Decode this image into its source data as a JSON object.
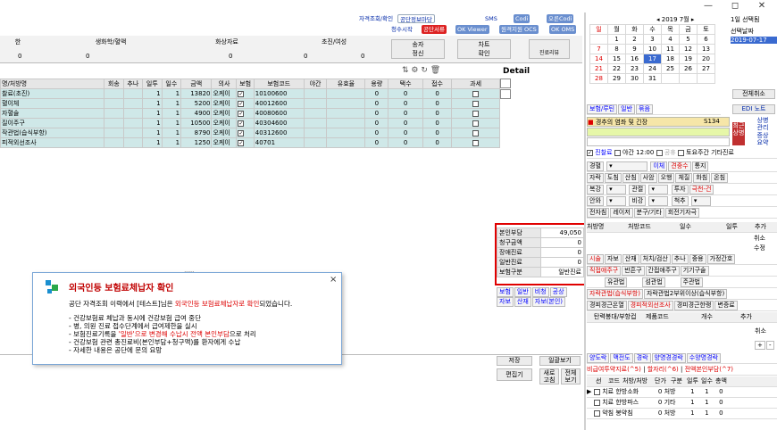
{
  "window_controls": [
    "—",
    "◻",
    "✕"
  ],
  "toolbar_top": {
    "row1": [
      "자격조회/확인",
      "공단정보마당",
      "SMS",
      "Codi",
      "오른Codi"
    ],
    "row2": [
      "청수시작",
      "공단서류",
      "OK Viewer",
      "원격지원 OCS",
      "OK OMS"
    ]
  },
  "header_cells": [
    "생화학/혈액",
    "화상자료",
    "초진/여성",
    "송자\n정신",
    "차트\n확인",
    "진료리뷰"
  ],
  "header_values": [
    "0",
    "0",
    "0",
    "0",
    "0"
  ],
  "header_left_label": "한",
  "grid": {
    "columns": [
      "명/처방명",
      "회송",
      "추나",
      "일투",
      "일수",
      "금액",
      "의사",
      "보험",
      "보험코드",
      "야간",
      "유효율",
      "용량",
      "택수",
      "접수",
      "과세"
    ],
    "rows": [
      {
        "name": "찰료(초진)",
        "v1": "1",
        "v2": "1",
        "amount": "13820",
        "doctor": "오케이",
        "ins": true,
        "code": "10100600",
        "c1": "0",
        "c2": "0",
        "c3": "0"
      },
      {
        "name": "혈이체",
        "v1": "1",
        "v2": "1",
        "amount": "5200",
        "doctor": "오케이",
        "ins": true,
        "code": "40012600",
        "c1": "0",
        "c2": "0",
        "c3": "0"
      },
      {
        "name": "자혈술",
        "v1": "1",
        "v2": "1",
        "amount": "4900",
        "doctor": "오케이",
        "ins": true,
        "code": "40080600",
        "c1": "0",
        "c2": "0",
        "c3": "0"
      },
      {
        "name": "질이주구",
        "v1": "1",
        "v2": "1",
        "amount": "10500",
        "doctor": "오케이",
        "ins": true,
        "code": "40304600",
        "c1": "0",
        "c2": "0",
        "c3": "0"
      },
      {
        "name": "작관법(습식부항)",
        "v1": "1",
        "v2": "1",
        "amount": "8790",
        "doctor": "오케이",
        "ins": true,
        "code": "40312600",
        "c1": "0",
        "c2": "0",
        "c3": "0"
      },
      {
        "name": "피적외선조사",
        "v1": "1",
        "v2": "1",
        "amount": "1250",
        "doctor": "오케이",
        "ins": true,
        "code": "40701",
        "c1": "0",
        "c2": "0",
        "c3": "0"
      }
    ]
  },
  "detail_label": "Detail",
  "summary": {
    "rows": [
      {
        "label": "본인부담",
        "value": "49,050"
      },
      {
        "label": "청구금액",
        "value": "0"
      },
      {
        "label": "장애진료",
        "value": "0"
      },
      {
        "label": "일반진료",
        "value": "0"
      },
      {
        "label": "보험구분",
        "value": "일반진료"
      }
    ]
  },
  "ins_row": [
    "보험",
    "일반",
    "비청",
    "공상",
    "자보",
    "산재",
    "자보(본인)"
  ],
  "bottom_buttons": [
    "저장",
    "일괄보기",
    "편집기",
    "새로\n고침",
    "전체\n보기"
  ],
  "dialog": {
    "title": "외국인등 보험료체납자 확인",
    "close": "×",
    "intro_a": "공단 자격조회 이력에서 [테스트]님은 ",
    "intro_b": "외국인등 보험료체납자로 확인",
    "intro_c": "되었습니다.",
    "b1": "- 건강보험료 체납과 동시에 건강보험 급여 중단",
    "b2": "- 병, 의원 진료 접수단계에서 급여제한을 실시",
    "b3a": "- 보험진료기록을 ",
    "b3b": "'일반'으로 변경해 수납시 전액 본인부담",
    "b3c": "으로 처리",
    "b4": "- 건강보험 관련 총진료비(본인부담+청구액)를 환자에게 수납",
    "b5": "- 자세한 내용은 공단에 문의 요망"
  },
  "calendar": {
    "month_label": "◂ 2019 7월 ▸",
    "select_label": "1일 선택됨",
    "weekdays": [
      "일",
      "월",
      "화",
      "수",
      "목",
      "금",
      "토"
    ],
    "weeks": [
      [
        "",
        "1",
        "2",
        "3",
        "4",
        "5",
        "6"
      ],
      [
        "7",
        "8",
        "9",
        "10",
        "11",
        "12",
        "13"
      ],
      [
        "14",
        "15",
        "16",
        "17",
        "18",
        "19",
        "20"
      ],
      [
        "21",
        "22",
        "23",
        "24",
        "25",
        "26",
        "27"
      ],
      [
        "28",
        "29",
        "30",
        "31",
        "",
        "",
        ""
      ]
    ],
    "side_label": "선택날짜",
    "side_date": "2019-07-17"
  },
  "right_panel": {
    "cancel_all": "전체취소",
    "edi_note": "EDI 노트",
    "tabs": [
      "보험/루틴",
      "일반",
      "묶음"
    ],
    "group_title": "경추의 염좌 및 긴장",
    "group_code": "S134",
    "side_a": "최근\n상병",
    "side_b": "상병\n관리",
    "side_c": "증상\n요약",
    "opts": [
      "진찰료",
      "야간",
      "12:00",
      "공휴",
      "토요주간",
      "기타진료"
    ],
    "r_a": [
      "경혈",
      "이체",
      "견중수",
      "통지"
    ],
    "r_b": [
      "자락",
      "도침",
      "산침",
      "사암",
      "오행",
      "체질",
      "화침",
      "온침"
    ],
    "r_c": [
      "복강",
      "관절",
      "투자",
      "극천-건"
    ],
    "r_d": [
      "안와",
      "비강",
      "척추"
    ],
    "r_e": [
      "전자침",
      "레이저",
      "분구/기타",
      "회전기자극"
    ],
    "presc_cols": [
      "처방명",
      "처방코드",
      "일수",
      "일투",
      "추가"
    ],
    "presc_btns": [
      "취소",
      "수정"
    ],
    "t_tabs": [
      "시술",
      "자보",
      "산재",
      "처치/검산",
      "추나",
      "중용",
      "가정간호"
    ],
    "t_row1": [
      "직접애주구",
      "반흔구",
      "간접애주구",
      "기기구술"
    ],
    "t_row2": [
      "유관법",
      "섬관법",
      "주관법"
    ],
    "t_row3": [
      "자락관법(습식부항)",
      "자락관법2부위이상(습식부항)"
    ],
    "t_row4": [
      "경피경근온열",
      "경피적외선조사",
      "경피경근한랭",
      "변증료"
    ],
    "t_cols": [
      "탄력봉대/부항컵",
      "제품코드",
      "개수",
      "추가"
    ],
    "t_btns": [
      "취소",
      "+",
      "-"
    ],
    "tab_b": [
      "양도락",
      "맥전도",
      "경락",
      "양명경경락",
      "수양명경락"
    ],
    "tab_b2": [
      "비급여투약지료(^5)",
      "할자리(^6)",
      "전액본인부담(^7)"
    ],
    "b_cols": [
      "선",
      "코드",
      "처방/처방",
      "단가",
      "구분",
      "일투",
      "일수",
      "총액"
    ],
    "b_rows": [
      {
        "tag": "치료",
        "name": "한방소화",
        "v": "0",
        "kind": "처방",
        "a": "1",
        "b": "1"
      },
      {
        "tag": "치료",
        "name": "한방파스",
        "v": "0",
        "kind": "기타",
        "a": "1",
        "b": "1"
      },
      {
        "tag": "약침",
        "name": "봉약침",
        "v": "0",
        "kind": "처방",
        "a": "1",
        "b": "1"
      }
    ],
    "b_total": "0"
  },
  "colors": {
    "accent_red": "#c00000",
    "highlight_box": "#e00000",
    "selected_row": "#cfe8e8",
    "dialog_title": "#c00000"
  }
}
